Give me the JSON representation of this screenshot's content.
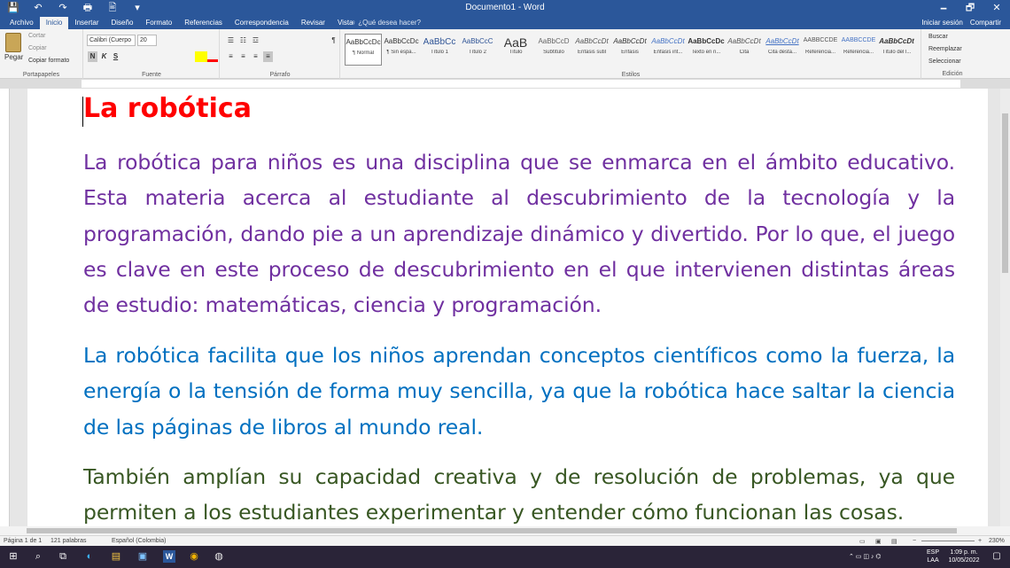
{
  "window": {
    "title": "Documento1 - Word",
    "qat": [
      "💾",
      "↶",
      "↷",
      "🖶",
      "🖹",
      "▾"
    ],
    "controls": [
      "🗕",
      "🗗",
      "✕"
    ]
  },
  "tabs": [
    "Archivo",
    "Inicio",
    "Insertar",
    "Diseño",
    "Formato",
    "Referencias",
    "Correspondencia",
    "Revisar",
    "Vista"
  ],
  "tell_me": "♀ ¿Qué desea hacer?",
  "account": {
    "signin": "Iniciar sesión",
    "share": "Compartir"
  },
  "ribbon": {
    "clipboard": {
      "paste": "Pegar",
      "cut": "Cortar",
      "copy": "Copiar",
      "format_painter": "Copiar formato",
      "label": "Portapapeles"
    },
    "font": {
      "name": "Calibri (Cuerpo",
      "size": "20",
      "bold": "N",
      "italic": "K",
      "underline": "S",
      "label": "Fuente"
    },
    "paragraph": {
      "label": "Párrafo"
    },
    "styles": {
      "label": "Estilos",
      "items": [
        {
          "preview": "AaBbCcDc",
          "name": "¶ Normal"
        },
        {
          "preview": "AaBbCcDc",
          "name": "¶ Sin espa..."
        },
        {
          "preview": "AaBbCc",
          "name": "Título 1"
        },
        {
          "preview": "AaBbCcC",
          "name": "Título 2"
        },
        {
          "preview": "AaB",
          "name": "Título"
        },
        {
          "preview": "AaBbCcD",
          "name": "Subtítulo"
        },
        {
          "preview": "AaBbCcDt",
          "name": "Énfasis sutil"
        },
        {
          "preview": "AaBbCcDt",
          "name": "Énfasis"
        },
        {
          "preview": "AaBbCcDt",
          "name": "Énfasis int..."
        },
        {
          "preview": "AaBbCcDc",
          "name": "Texto en n..."
        },
        {
          "preview": "AaBbCcDt",
          "name": "Cita"
        },
        {
          "preview": "AaBbCcDt",
          "name": "Cita desta..."
        },
        {
          "preview": "AABBCCDE",
          "name": "Referencia..."
        },
        {
          "preview": "AABBCCDE",
          "name": "Referencia..."
        },
        {
          "preview": "AaBbCcDt",
          "name": "Título del l..."
        }
      ]
    },
    "editing": {
      "find": "Buscar",
      "replace": "Reemplazar",
      "select": "Seleccionar",
      "label": "Edición"
    }
  },
  "document": {
    "heading": "La robótica",
    "paragraphs": [
      "La robótica para niños es una disciplina que se enmarca en el ámbito educativo. Esta materia acerca al estudiante al descubrimiento de la tecnología y la programación, dando pie a un aprendizaje dinámico y divertido.  Por lo que, el juego es clave en este proceso de descubrimiento en el que intervienen distintas áreas de estudio: matemáticas, ciencia y programación.",
      "La robótica facilita que los niños aprendan conceptos científicos como la fuerza, la energía o la tensión de forma muy sencilla, ya que la robótica hace saltar la ciencia de las páginas de libros al mundo real.",
      "También amplían su capacidad creativa y de resolución de problemas, ya que permiten a los estudiantes experimentar y entender cómo funcionan las cosas."
    ],
    "colors": {
      "heading": "#ff0000",
      "p1": "#7030a0",
      "p2": "#0070c0",
      "p3": "#385723"
    }
  },
  "status": {
    "page": "Página 1 de 1",
    "words": "121 palabras",
    "language": "Español (Colombia)",
    "zoom": "230%"
  },
  "taskbar": {
    "icons": [
      "⊞",
      "⌕",
      "⧉",
      "◐",
      "▤",
      "▣",
      "W",
      "◉",
      "◍"
    ],
    "lang": "ESP",
    "lang2": "LAA",
    "time": "1:09 p. m.",
    "date": "10/05/2022"
  }
}
